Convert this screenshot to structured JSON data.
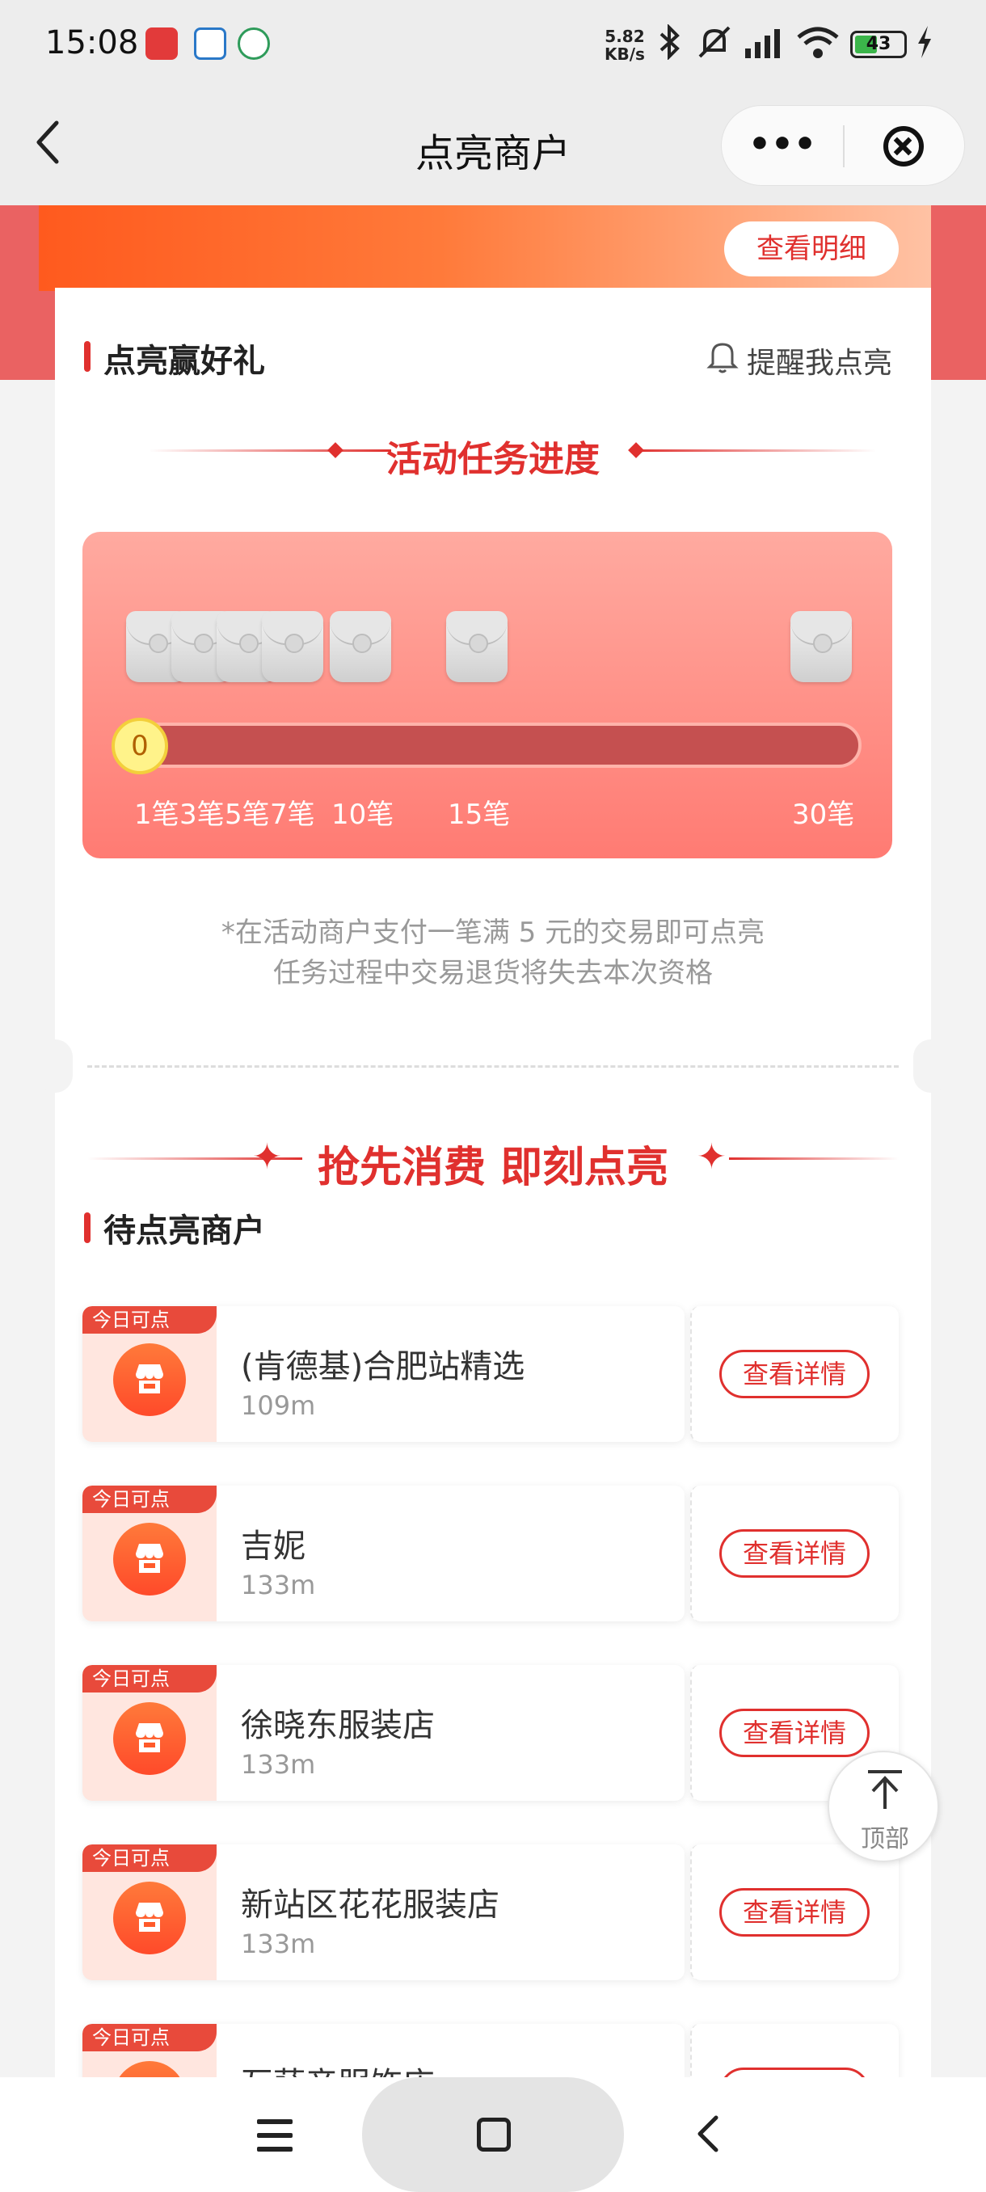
{
  "status_bar": {
    "time": "15:08",
    "net_speed_value": "5.82",
    "net_speed_unit": "KB/s",
    "battery": "43",
    "icons": [
      "app-icon-red",
      "app-icon-blue",
      "app-icon-green",
      "bluetooth-icon",
      "mute-icon",
      "signal-icon",
      "wifi-icon",
      "battery-icon",
      "charging-icon"
    ],
    "battery_color": "#3bb54a"
  },
  "nav": {
    "title": "点亮商户",
    "more_label": "•••"
  },
  "banner": {
    "detail_button": "查看明细"
  },
  "reward_section": {
    "title": "点亮赢好礼",
    "remind": "提醒我点亮",
    "progress_title": "活动任务进度",
    "current_count": "0",
    "current_progress": 0,
    "milestones": [
      "1笔",
      "3笔",
      "5笔",
      "7笔",
      "10笔",
      "15笔",
      "30笔"
    ],
    "note_line1": "*在活动商户支付一笔满 5 元的交易即可点亮",
    "note_line2": "任务过程中交易退货将失去本次资格"
  },
  "merchant_section": {
    "banner_title": "抢先消费 即刻点亮",
    "title": "待点亮商户",
    "tag": "今日可点",
    "button_label": "查看详情",
    "items": [
      {
        "name": "(肯德基)合肥站精选",
        "distance": "109m"
      },
      {
        "name": "吉妮",
        "distance": "133m"
      },
      {
        "name": "徐晓东服装店",
        "distance": "133m"
      },
      {
        "name": "新站区花花服装店",
        "distance": "133m"
      },
      {
        "name": "瓦萨帝服饰店",
        "distance": ""
      }
    ]
  },
  "to_top": {
    "label": "顶部"
  },
  "colors": {
    "accent": "#e0302e",
    "banner_bg": "#ea6262",
    "panel_top": "#ffaaa0",
    "panel_bottom": "#ff7b73"
  }
}
